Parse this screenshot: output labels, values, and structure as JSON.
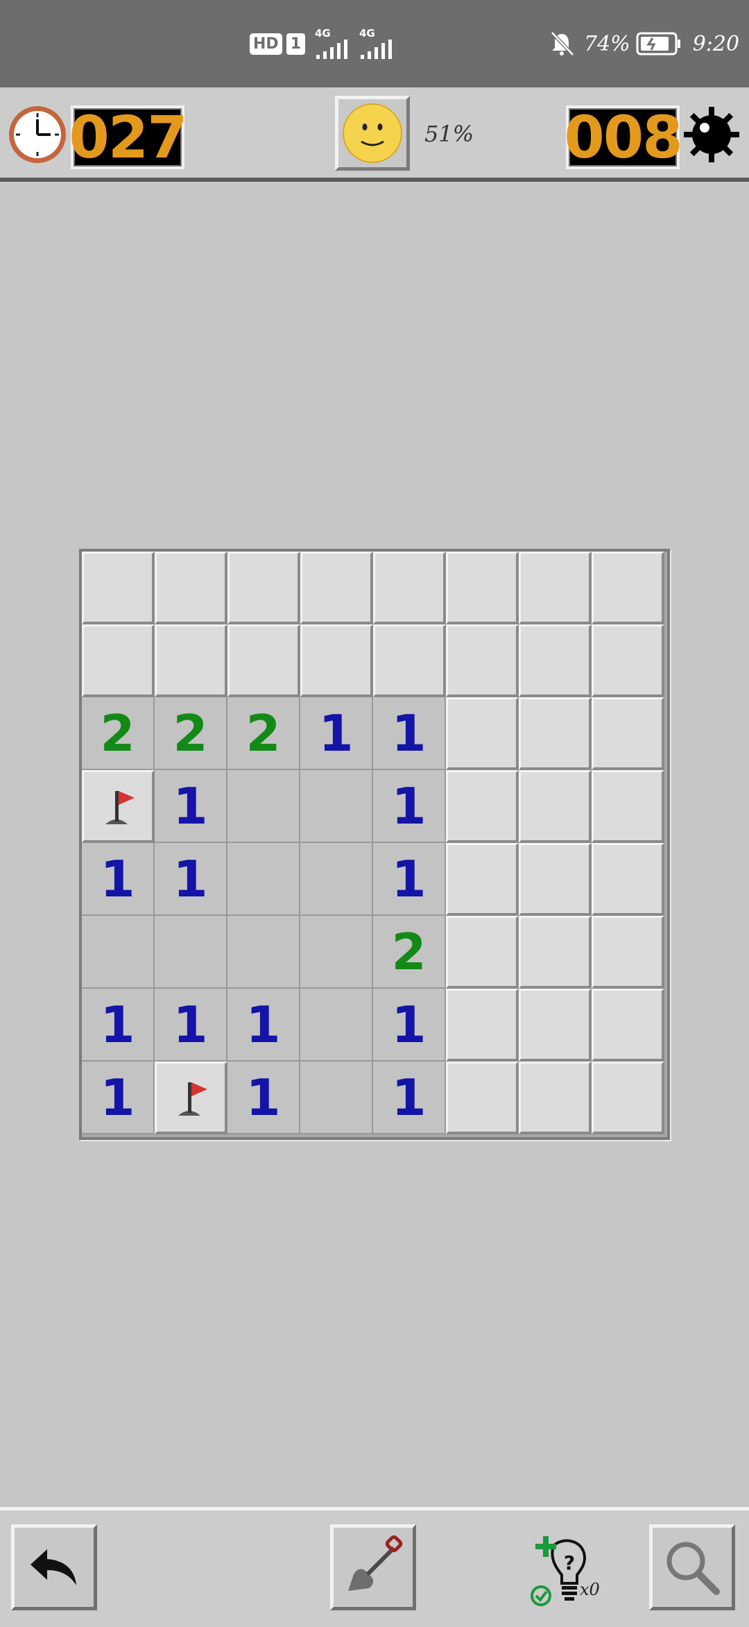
{
  "status_bar": {
    "hd": "HD",
    "sim": "1",
    "net1": "4G",
    "net2": "4G",
    "battery": "74%",
    "time": "9:20"
  },
  "header": {
    "timer": "027",
    "progress": "51%",
    "mines_left": "008",
    "counter_color": "#e39a1c"
  },
  "board": {
    "rows": 8,
    "cols": 8,
    "cells": [
      [
        "#",
        "#",
        "#",
        "#",
        "#",
        "#",
        "#",
        "#"
      ],
      [
        "#",
        "#",
        "#",
        "#",
        "#",
        "#",
        "#",
        "#"
      ],
      [
        "2",
        "2",
        "2",
        "1",
        "1",
        "#",
        "#",
        "#"
      ],
      [
        "F",
        "1",
        "",
        "",
        "1",
        "#",
        "#",
        "#"
      ],
      [
        "1",
        "1",
        "",
        "",
        "1",
        "#",
        "#",
        "#"
      ],
      [
        "",
        "",
        "",
        "",
        "2",
        "#",
        "#",
        "#"
      ],
      [
        "1",
        "1",
        "1",
        "",
        "1",
        "#",
        "#",
        "#"
      ],
      [
        "1",
        "F",
        "1",
        "",
        "1",
        "#",
        "#",
        "#"
      ]
    ],
    "number_colors": {
      "1": "#1414a8",
      "2": "#138a18"
    }
  },
  "bottom": {
    "hint_count": "x0",
    "icons": [
      "undo-icon",
      "shovel-icon",
      "hint-lightbulb-icon",
      "magnifier-icon"
    ]
  }
}
